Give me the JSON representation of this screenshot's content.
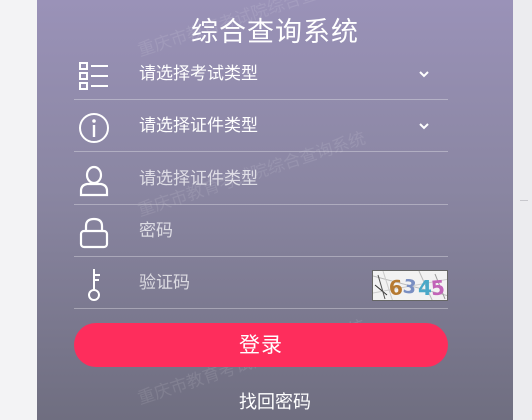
{
  "page": {
    "title": "综合查询系统"
  },
  "form": {
    "exam_type": {
      "value": "请选择考试类型",
      "icon": "list-icon"
    },
    "cert_type": {
      "value": "请选择证件类型",
      "icon": "info-icon"
    },
    "cert_number": {
      "placeholder": "请选择证件类型",
      "icon": "user-icon"
    },
    "password": {
      "placeholder": "密码",
      "icon": "lock-icon"
    },
    "captcha": {
      "placeholder": "验证码",
      "icon": "key-icon",
      "image_text": "6345"
    }
  },
  "actions": {
    "login_label": "登录",
    "forgot_label": "找回密码"
  },
  "watermark": {
    "text": "重庆市教育考试院综合查询系统"
  },
  "colors": {
    "panel_top": "#9a92b8",
    "panel_bottom": "#6f6e80",
    "login_button": "#fe2d5c"
  }
}
